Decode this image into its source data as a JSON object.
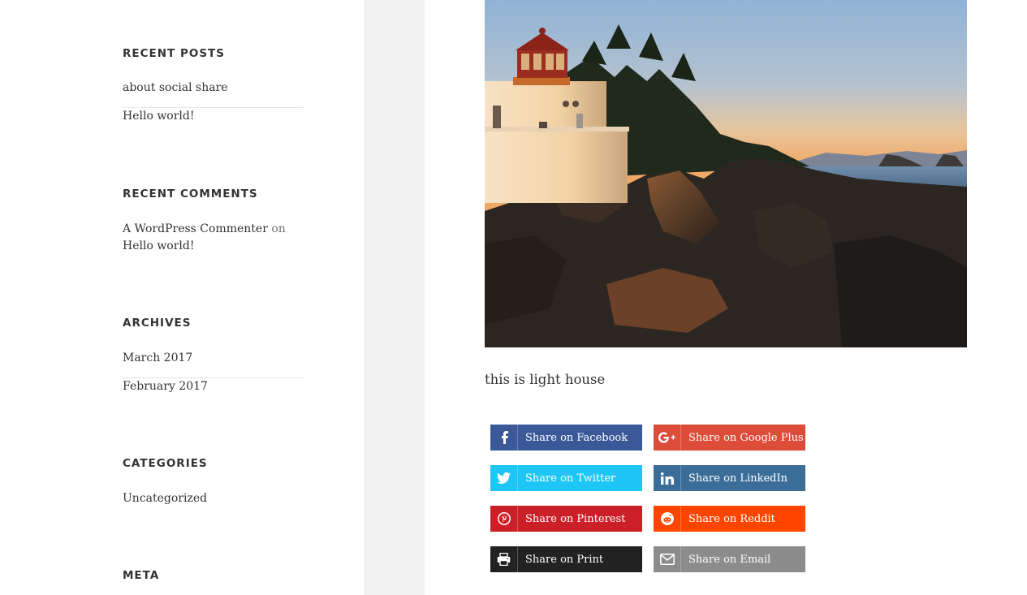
{
  "sidebar": {
    "recent_posts": {
      "title": "RECENT POSTS",
      "items": [
        "about social share",
        "Hello world!"
      ]
    },
    "recent_comments": {
      "title": "RECENT COMMENTS",
      "author": "A WordPress Commenter",
      "on": "on",
      "post": "Hello world!"
    },
    "archives": {
      "title": "ARCHIVES",
      "items": [
        "March 2017",
        "February 2017"
      ]
    },
    "categories": {
      "title": "CATEGORIES",
      "items": [
        "Uncategorized"
      ]
    },
    "meta": {
      "title": "META"
    }
  },
  "post": {
    "caption": "this is light house"
  },
  "share": {
    "facebook": {
      "label": "Share on Facebook",
      "color": "#3b5998",
      "icon": "facebook-icon"
    },
    "google": {
      "label": "Share on Google Plus",
      "color": "#dd4b39",
      "icon": "google-plus-icon"
    },
    "twitter": {
      "label": "Share on Twitter",
      "color": "#1dc6f4",
      "icon": "twitter-icon"
    },
    "linkedin": {
      "label": "Share on LinkedIn",
      "color": "#3a6e99",
      "icon": "linkedin-icon"
    },
    "pinterest": {
      "label": "Share on Pinterest",
      "color": "#cb2027",
      "icon": "pinterest-icon"
    },
    "reddit": {
      "label": "Share on Reddit",
      "color": "#ff4500",
      "icon": "reddit-icon"
    },
    "print": {
      "label": "Share on Print",
      "color": "#222222",
      "icon": "print-icon"
    },
    "email": {
      "label": "Share on Email",
      "color": "#8c8c8c",
      "icon": "email-icon"
    }
  }
}
